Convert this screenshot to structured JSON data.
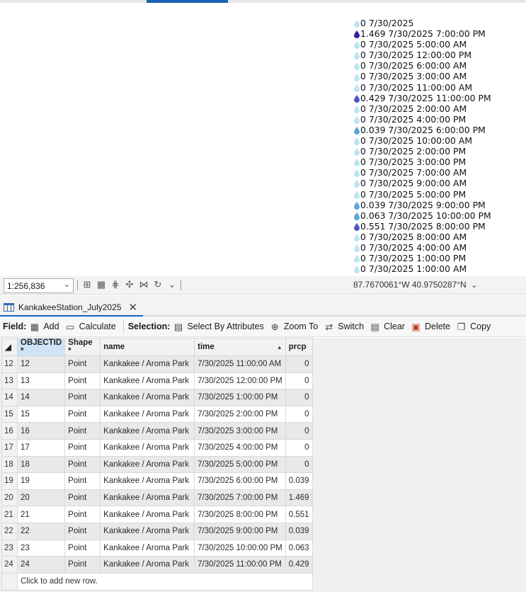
{
  "map": {
    "labels": [
      {
        "text": "0 7/30/2025",
        "level": 0
      },
      {
        "text": "1.469 7/30/2025 7:00:00 PM",
        "level": 3
      },
      {
        "text": "0 7/30/2025 5:00:00 AM",
        "level": 0
      },
      {
        "text": "0 7/30/2025 12:00:00 PM",
        "level": 0
      },
      {
        "text": "0 7/30/2025 6:00:00 AM",
        "level": 0
      },
      {
        "text": "0 7/30/2025 3:00:00 AM",
        "level": 0
      },
      {
        "text": "0 7/30/2025 11:00:00 AM",
        "level": 0
      },
      {
        "text": "0.429 7/30/2025 11:00:00 PM",
        "level": 2
      },
      {
        "text": "0 7/30/2025 2:00:00 AM",
        "level": 0
      },
      {
        "text": "0 7/30/2025 4:00:00 PM",
        "level": 0
      },
      {
        "text": "0.039 7/30/2025 6:00:00 PM",
        "level": 1
      },
      {
        "text": "0 7/30/2025 10:00:00 AM",
        "level": 0
      },
      {
        "text": "0 7/30/2025 2:00:00 PM",
        "level": 0
      },
      {
        "text": "0 7/30/2025 3:00:00 PM",
        "level": 0
      },
      {
        "text": "0 7/30/2025 7:00:00 AM",
        "level": 0
      },
      {
        "text": "0 7/30/2025 9:00:00 AM",
        "level": 0
      },
      {
        "text": "0 7/30/2025 5:00:00 PM",
        "level": 0
      },
      {
        "text": "0.039 7/30/2025 9:00:00 PM",
        "level": 1
      },
      {
        "text": "0.063 7/30/2025 10:00:00 PM",
        "level": 1
      },
      {
        "text": "0.551 7/30/2025 8:00:00 PM",
        "level": 2
      },
      {
        "text": "0 7/30/2025 8:00:00 AM",
        "level": 0
      },
      {
        "text": "0 7/30/2025 4:00:00 AM",
        "level": 0
      },
      {
        "text": "0 7/30/2025 1:00:00 PM",
        "level": 0
      },
      {
        "text": "0 7/30/2025 1:00:00 AM",
        "level": 0
      }
    ],
    "symbol_colors": [
      "#bfe3f2",
      "#5aa7d8",
      "#4d59c9",
      "#3a1c9e"
    ]
  },
  "status": {
    "scale": "1:256,836",
    "coordinates": "87.7670061°W 40.9750287°N"
  },
  "table_tab": {
    "title": "KankakeeStation_July2025"
  },
  "ribbon": {
    "field_label": "Field:",
    "add": "Add",
    "calculate": "Calculate",
    "selection_label": "Selection:",
    "select_by_attributes": "Select By Attributes",
    "zoom_to": "Zoom To",
    "switch": "Switch",
    "clear": "Clear",
    "delete": "Delete",
    "copy": "Copy"
  },
  "grid": {
    "columns": [
      "OBJECTID *",
      "Shape *",
      "name",
      "time",
      "prcp"
    ],
    "rows": [
      {
        "n": "12",
        "id": "12",
        "shape": "Point",
        "name": "Kankakee / Aroma Park",
        "time": "7/30/2025 11:00:00 AM",
        "prcp": "0"
      },
      {
        "n": "13",
        "id": "13",
        "shape": "Point",
        "name": "Kankakee / Aroma Park",
        "time": "7/30/2025 12:00:00 PM",
        "prcp": "0"
      },
      {
        "n": "14",
        "id": "14",
        "shape": "Point",
        "name": "Kankakee / Aroma Park",
        "time": "7/30/2025 1:00:00 PM",
        "prcp": "0"
      },
      {
        "n": "15",
        "id": "15",
        "shape": "Point",
        "name": "Kankakee / Aroma Park",
        "time": "7/30/2025 2:00:00 PM",
        "prcp": "0"
      },
      {
        "n": "16",
        "id": "16",
        "shape": "Point",
        "name": "Kankakee / Aroma Park",
        "time": "7/30/2025 3:00:00 PM",
        "prcp": "0"
      },
      {
        "n": "17",
        "id": "17",
        "shape": "Point",
        "name": "Kankakee / Aroma Park",
        "time": "7/30/2025 4:00:00 PM",
        "prcp": "0"
      },
      {
        "n": "18",
        "id": "18",
        "shape": "Point",
        "name": "Kankakee / Aroma Park",
        "time": "7/30/2025 5:00:00 PM",
        "prcp": "0"
      },
      {
        "n": "19",
        "id": "19",
        "shape": "Point",
        "name": "Kankakee / Aroma Park",
        "time": "7/30/2025 6:00:00 PM",
        "prcp": "0.039"
      },
      {
        "n": "20",
        "id": "20",
        "shape": "Point",
        "name": "Kankakee / Aroma Park",
        "time": "7/30/2025 7:00:00 PM",
        "prcp": "1.469"
      },
      {
        "n": "21",
        "id": "21",
        "shape": "Point",
        "name": "Kankakee / Aroma Park",
        "time": "7/30/2025 8:00:00 PM",
        "prcp": "0.551"
      },
      {
        "n": "22",
        "id": "22",
        "shape": "Point",
        "name": "Kankakee / Aroma Park",
        "time": "7/30/2025 9:00:00 PM",
        "prcp": "0.039"
      },
      {
        "n": "23",
        "id": "23",
        "shape": "Point",
        "name": "Kankakee / Aroma Park",
        "time": "7/30/2025 10:00:00 PM",
        "prcp": "0.063"
      },
      {
        "n": "24",
        "id": "24",
        "shape": "Point",
        "name": "Kankakee / Aroma Park",
        "time": "7/30/2025 11:00:00 PM",
        "prcp": "0.429"
      }
    ],
    "add_row_text": "Click to add new row."
  }
}
